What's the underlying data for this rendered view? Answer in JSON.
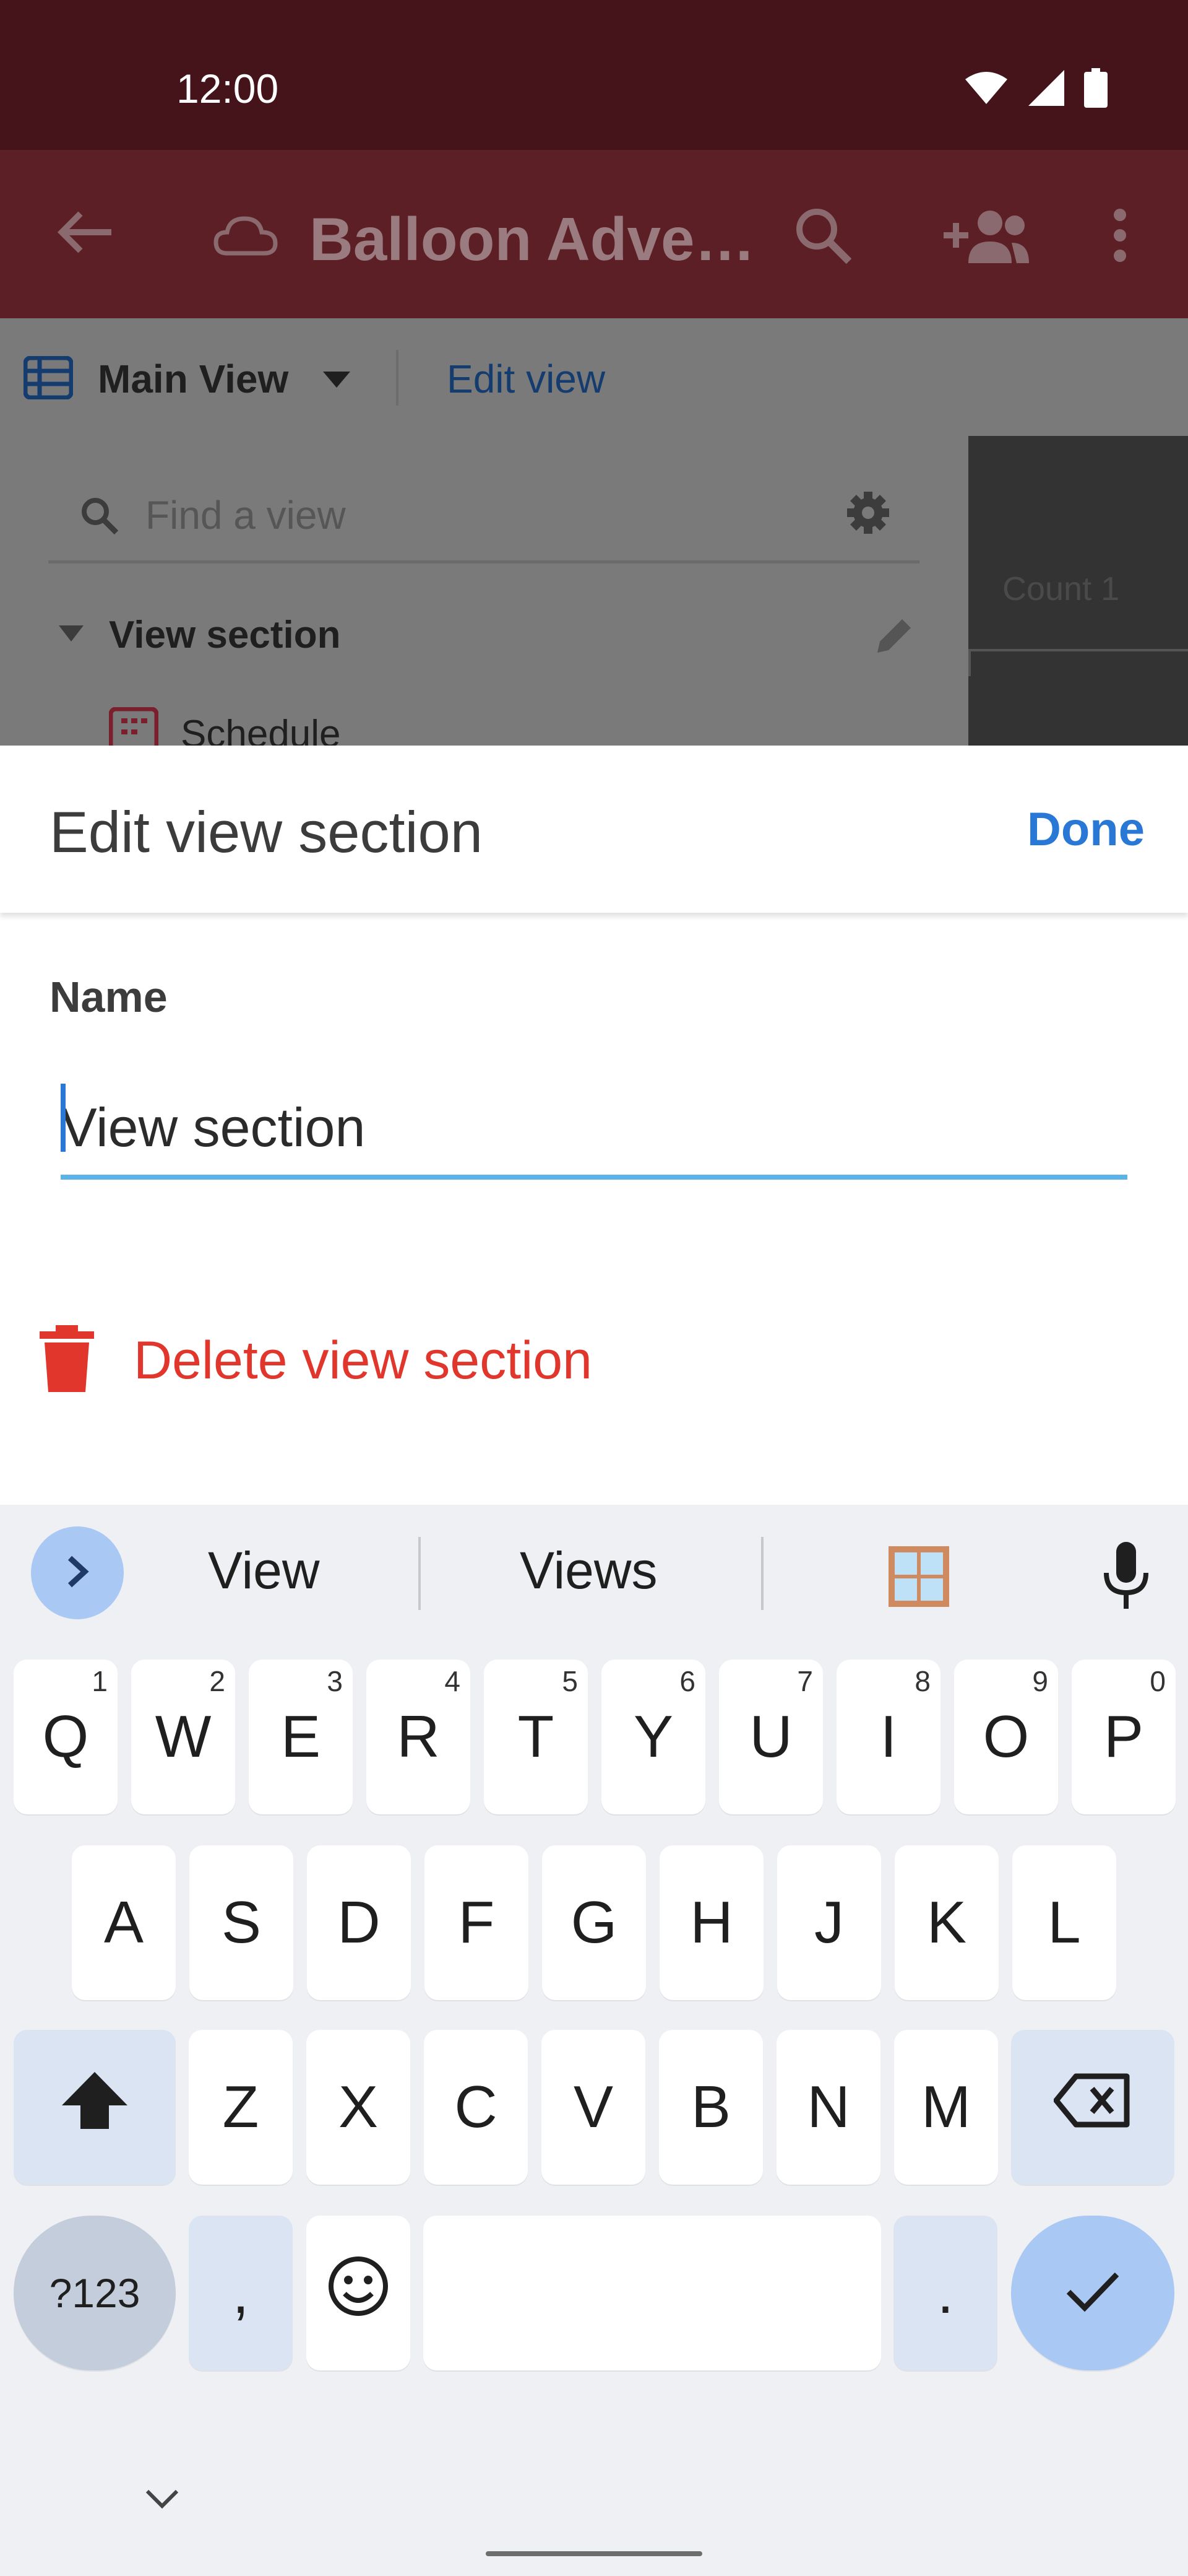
{
  "status_bar": {
    "time": "12:00",
    "icons": [
      "wifi-icon",
      "signal-icon",
      "battery-icon"
    ]
  },
  "app_bar": {
    "title": "Balloon Adve…",
    "icons": [
      "back-arrow-icon",
      "cloud-icon",
      "search-icon",
      "add-people-icon",
      "more-vert-icon"
    ]
  },
  "view_bar": {
    "current_view": "Main View",
    "edit_view_label": "Edit view"
  },
  "view_panel": {
    "search_placeholder": "Find a view",
    "section_name": "View section",
    "view_item": "Schedule",
    "column_label": "Count 1"
  },
  "sheet": {
    "title": "Edit view section",
    "done_label": "Done",
    "name_label": "Name",
    "name_value": "View section",
    "delete_label": "Delete view section"
  },
  "keyboard": {
    "suggestions": [
      "View",
      "Views"
    ],
    "row1": [
      {
        "label": "Q",
        "hint": "1"
      },
      {
        "label": "W",
        "hint": "2"
      },
      {
        "label": "E",
        "hint": "3"
      },
      {
        "label": "R",
        "hint": "4"
      },
      {
        "label": "T",
        "hint": "5"
      },
      {
        "label": "Y",
        "hint": "6"
      },
      {
        "label": "U",
        "hint": "7"
      },
      {
        "label": "I",
        "hint": "8"
      },
      {
        "label": "O",
        "hint": "9"
      },
      {
        "label": "P",
        "hint": "0"
      }
    ],
    "row2": [
      "A",
      "S",
      "D",
      "F",
      "G",
      "H",
      "J",
      "K",
      "L"
    ],
    "row3": [
      "Z",
      "X",
      "C",
      "V",
      "B",
      "N",
      "M"
    ],
    "symbols_label": "?123",
    "comma_label": ",",
    "period_label": "."
  },
  "colors": {
    "status_bar": "#45141b",
    "app_bar": "#5c1f25",
    "accent_blue": "#2a78d6",
    "delete_red": "#e0362c",
    "input_underline": "#5ab4ea"
  }
}
